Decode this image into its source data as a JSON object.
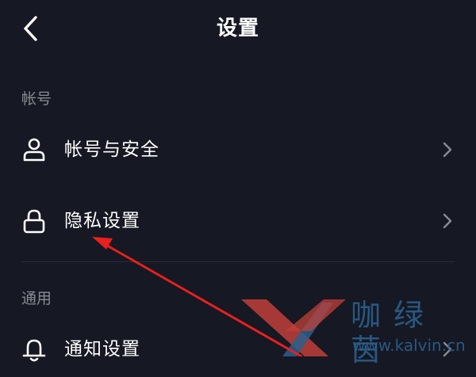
{
  "header": {
    "title": "设置"
  },
  "sections": [
    {
      "title": "帐号",
      "items": [
        {
          "label": "帐号与安全",
          "icon": "user-icon"
        },
        {
          "label": "隐私设置",
          "icon": "lock-icon"
        }
      ]
    },
    {
      "title": "通用",
      "items": [
        {
          "label": "通知设置",
          "icon": "bell-icon"
        }
      ]
    }
  ],
  "watermark": {
    "text": "咖绿茵",
    "url": "www.kalvin.cn"
  },
  "colors": {
    "background": "#161823",
    "section_header": "#8a8b91",
    "divider": "#2b2c36",
    "annotation_arrow": "#e8201f",
    "watermark": "#2b5f8c"
  }
}
